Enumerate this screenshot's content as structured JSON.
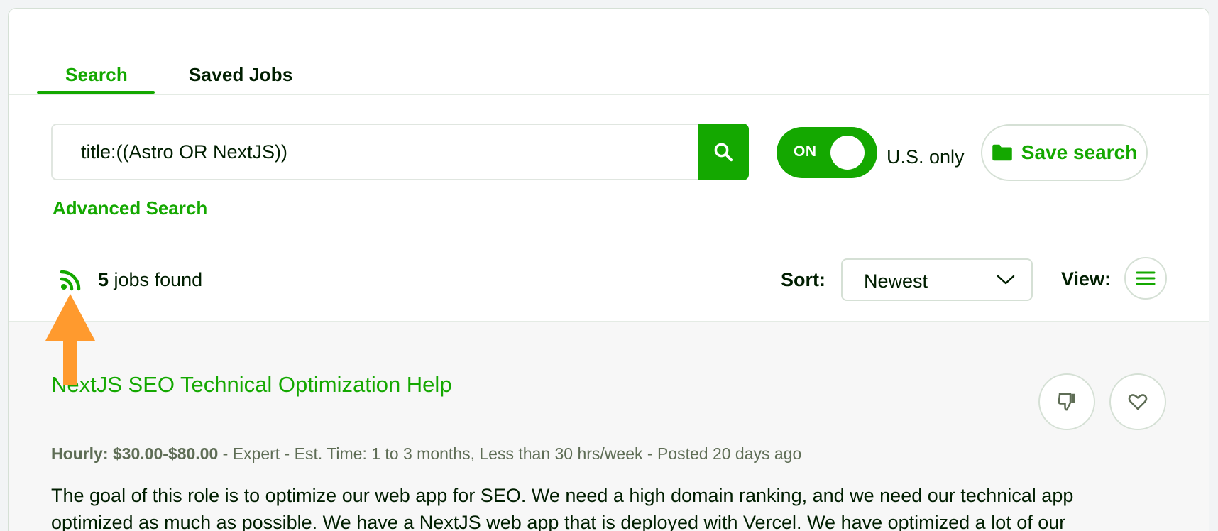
{
  "tabs": [
    {
      "label": "Search",
      "active": true
    },
    {
      "label": "Saved Jobs",
      "active": false
    }
  ],
  "search": {
    "value": "title:((Astro OR NextJS))",
    "button_icon": "search-icon"
  },
  "filters": {
    "toggle_label": "ON",
    "toggle_on": true,
    "us_only_label": "U.S. only"
  },
  "save_search": {
    "label": "Save search",
    "icon": "folder-icon"
  },
  "advanced_search_label": "Advanced Search",
  "results_bar": {
    "count": "5",
    "count_suffix": " jobs found",
    "rss_icon": "rss-icon",
    "sort_label": "Sort:",
    "sort_value": "Newest",
    "view_label": "View:",
    "view_icon": "list-view-icon"
  },
  "job": {
    "title": "NextJS SEO Technical Optimization Help",
    "rate_label": "Hourly: $30.00-$80.00",
    "meta_rest": " - Expert - Est. Time: 1 to 3 months, Less than 30 hrs/week - Posted 20 days ago",
    "description": "The goal of this role is to optimize our web app for SEO. We need a high domain ranking, and we need our technical app optimized as much as possible. We have a NextJS web app that is deployed with Vercel. We have optimized a lot of our"
  },
  "colors": {
    "accent": "#14a800",
    "text": "#001e00",
    "muted": "#5e6d55",
    "annotation_arrow": "#ff9a2e"
  }
}
